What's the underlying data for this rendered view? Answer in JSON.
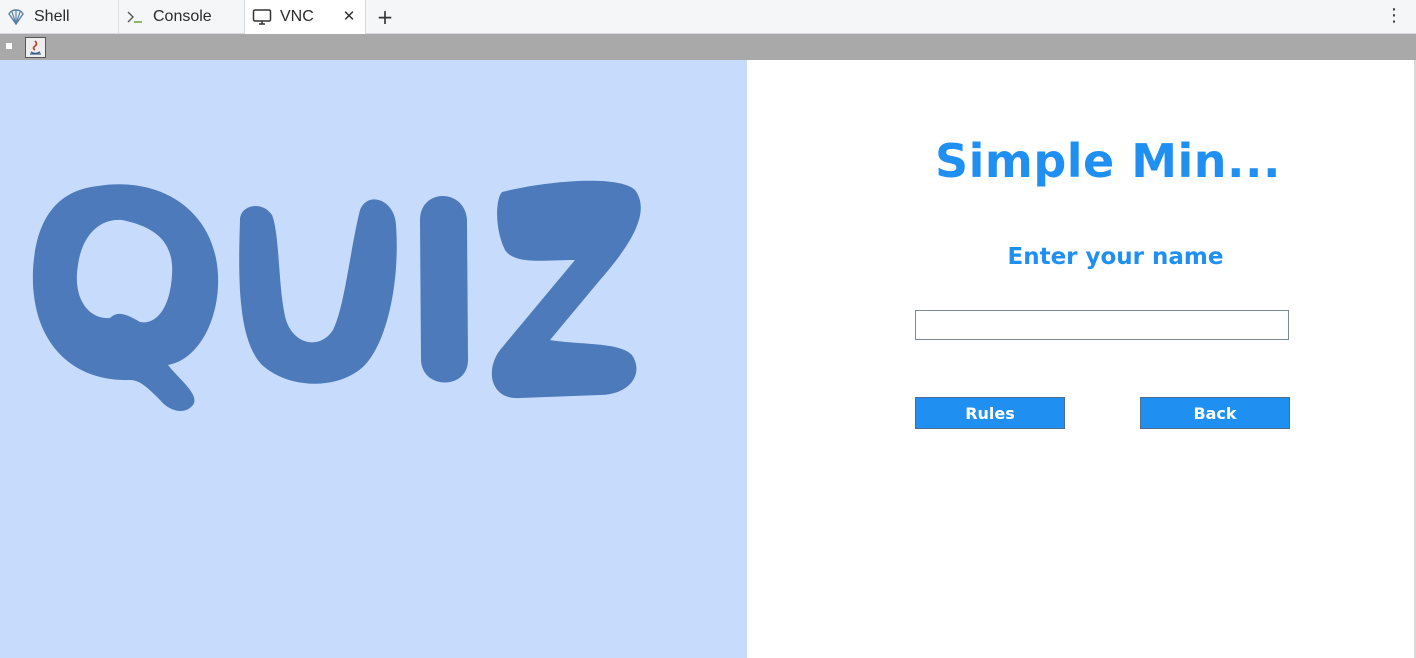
{
  "tabs": [
    {
      "label": "Shell",
      "icon": "shell-icon",
      "active": false
    },
    {
      "label": "Console",
      "icon": "console-icon",
      "active": false
    },
    {
      "label": "VNC",
      "icon": "monitor-icon",
      "active": true
    }
  ],
  "tab_close_icon": "close-icon",
  "new_tab_icon": "plus-icon",
  "menu_icon": "kebab-menu-icon",
  "toolbar": {
    "icons": [
      "square-icon",
      "java-icon"
    ]
  },
  "app": {
    "logo_text": "QUIZ",
    "title": "Simple Min...",
    "prompt": "Enter your name",
    "name_input": {
      "value": "",
      "placeholder": ""
    },
    "rules_label": "Rules",
    "back_label": "Back"
  },
  "colors": {
    "accent": "#1f8ff2",
    "left_panel_bg": "#c7dcfc",
    "logo_fill": "#4d7aba",
    "toolbar_bg": "#a9a9a9"
  }
}
